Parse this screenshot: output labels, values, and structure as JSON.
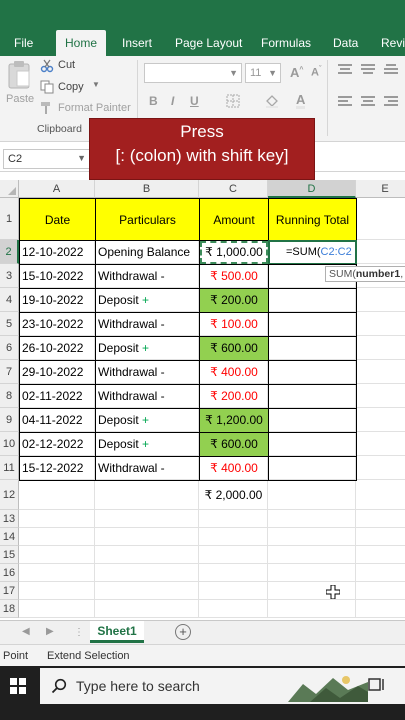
{
  "ribbon_tabs": [
    "File",
    "Home",
    "Insert",
    "Page Layout",
    "Formulas",
    "Data",
    "Revi"
  ],
  "active_tab": "Home",
  "clipboard": {
    "paste": "Paste",
    "cut": "Cut",
    "copy": "Copy",
    "format_painter": "Format Painter",
    "group_name": "Clipboard"
  },
  "font": {
    "size": "11"
  },
  "overlay": {
    "line1": "Press",
    "line2": "[: (colon) with shift key]"
  },
  "name_box": "C2",
  "columns": [
    "A",
    "B",
    "C",
    "D",
    "E"
  ],
  "table": {
    "headers": {
      "date": "Date",
      "particulars": "Particulars",
      "amount": "Amount",
      "running_total": "Running Total"
    },
    "rows": [
      {
        "row": "2",
        "date": "12-10-2022",
        "particulars": "Opening Balance",
        "amount": "₹ 1,000.00",
        "type": "opening"
      },
      {
        "row": "3",
        "date": "15-10-2022",
        "particulars": "Withdrawal -",
        "amount": "₹ 500.00",
        "type": "withdrawal"
      },
      {
        "row": "4",
        "date": "19-10-2022",
        "particulars": "Deposit +",
        "amount": "₹ 200.00",
        "type": "deposit"
      },
      {
        "row": "5",
        "date": "23-10-2022",
        "particulars": "Withdrawal -",
        "amount": "₹ 100.00",
        "type": "withdrawal"
      },
      {
        "row": "6",
        "date": "26-10-2022",
        "particulars": "Deposit +",
        "amount": "₹ 600.00",
        "type": "deposit"
      },
      {
        "row": "7",
        "date": "29-10-2022",
        "particulars": "Withdrawal -",
        "amount": "₹ 400.00",
        "type": "withdrawal"
      },
      {
        "row": "8",
        "date": "02-11-2022",
        "particulars": "Withdrawal -",
        "amount": "₹ 200.00",
        "type": "withdrawal"
      },
      {
        "row": "9",
        "date": "04-11-2022",
        "particulars": "Deposit +",
        "amount": "₹ 1,200.00",
        "type": "deposit"
      },
      {
        "row": "10",
        "date": "02-12-2022",
        "particulars": "Deposit +",
        "amount": "₹ 600.00",
        "type": "deposit"
      },
      {
        "row": "11",
        "date": "15-12-2022",
        "particulars": "Withdrawal -",
        "amount": "₹ 400.00",
        "type": "withdrawal"
      }
    ],
    "total": "₹ 2,000.00"
  },
  "formula": {
    "prefix": "=SUM(",
    "ref": "C2:C2"
  },
  "tooltip": {
    "func": "SUM(",
    "arg": "number1",
    "tail": ","
  },
  "row_numbers": [
    "1",
    "2",
    "3",
    "4",
    "5",
    "6",
    "7",
    "8",
    "9",
    "10",
    "11",
    "12",
    "13",
    "14",
    "15",
    "16",
    "17",
    "18"
  ],
  "sheet_tab": "Sheet1",
  "status": {
    "mode": "Point",
    "extend": "Extend Selection"
  },
  "taskbar": {
    "search_placeholder": "Type here to search"
  },
  "colors": {
    "excel_green": "#217346",
    "header_yellow": "#ffff00",
    "deposit_green": "#92d050",
    "withdrawal_red": "#ff0000",
    "overlay_red": "#a21f1f"
  }
}
